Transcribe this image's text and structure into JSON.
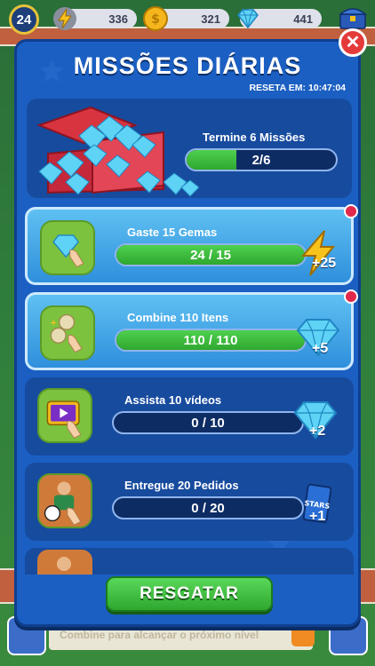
{
  "hud": {
    "level": "24",
    "energy": "336",
    "coins": "321",
    "gems": "441"
  },
  "bg": {
    "banner_text": "Combine para alcançar o próximo nível"
  },
  "modal": {
    "title": "MISSÕES DIÁRIAS",
    "reset_label": "RESETA EM:",
    "reset_time": "10:47:04",
    "header": {
      "label": "Termine 6 Missões",
      "progress_text": "2/6",
      "progress_value": 2,
      "progress_max": 6
    },
    "missions": [
      {
        "label": "Gaste 15 Gemas",
        "progress_text": "24 / 15",
        "fill": 1.0,
        "reward_icon": "energy-bolt-icon",
        "reward_amount": "+25",
        "completed": true
      },
      {
        "label": "Combine 110 Itens",
        "progress_text": "110 / 110",
        "fill": 1.0,
        "reward_icon": "gem-icon",
        "reward_amount": "+5",
        "completed": true
      },
      {
        "label": "Assista 10 vídeos",
        "progress_text": "0 / 10",
        "fill": 0.0,
        "reward_icon": "gem-icon",
        "reward_amount": "+2",
        "completed": false
      },
      {
        "label": "Entregue 20 Pedidos",
        "progress_text": "0 / 20",
        "fill": 0.0,
        "reward_icon": "stars-pack-icon",
        "reward_amount": "+1",
        "completed": false
      }
    ],
    "claim_button": "RESGATAR"
  },
  "colors": {
    "modal_bg": "#1b5fc2",
    "card_bg": "#174b9e",
    "progress_green": "#3cbc3c",
    "close_red": "#e53a3a"
  }
}
